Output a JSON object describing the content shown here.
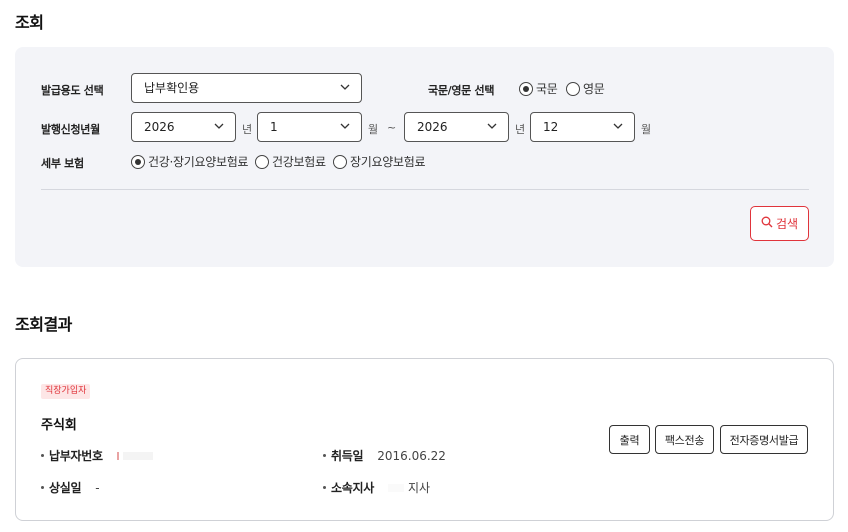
{
  "search_section": {
    "title": "조회",
    "purpose": {
      "label": "발급용도 선택",
      "value": "납부확인용"
    },
    "language": {
      "label": "국문/영문 선택",
      "options": [
        {
          "label": "국문",
          "checked": true
        },
        {
          "label": "영문",
          "checked": false
        }
      ]
    },
    "period": {
      "label": "발행신청년월",
      "from_year": "2026",
      "year_unit": "년",
      "from_month": "1",
      "month_unit": "월",
      "separator": "~",
      "to_year": "2026",
      "to_month": "12"
    },
    "insurance": {
      "label": "세부 보험",
      "options": [
        {
          "label": "건강·장기요양보험료",
          "checked": true
        },
        {
          "label": "건강보험료",
          "checked": false
        },
        {
          "label": "장기요양보험료",
          "checked": false
        }
      ]
    },
    "search_button": "검색"
  },
  "result_section": {
    "title": "조회결과",
    "card": {
      "badge": "직장가입자",
      "company": "주식회",
      "fields": {
        "payer_no_label": "납부자번호",
        "payer_no_value": "",
        "acquire_label": "취득일",
        "acquire_value": "2016.06.22",
        "loss_label": "상실일",
        "loss_value": "-",
        "branch_label": "소속지사",
        "branch_value": "지사"
      },
      "buttons": {
        "print": "출력",
        "fax": "팩스전송",
        "e_cert": "전자증명서발급"
      }
    }
  },
  "colors": {
    "accent": "#e0343b",
    "panel_bg": "#f3f4f8",
    "badge_bg": "#fde6e6"
  },
  "icons": {
    "dropdown": "chevron-down-icon",
    "search": "search-icon"
  }
}
